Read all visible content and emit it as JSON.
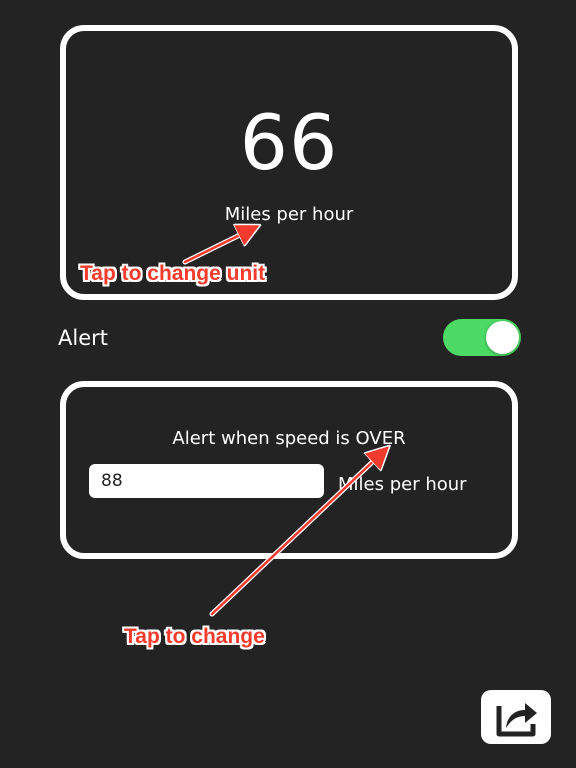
{
  "speed": {
    "value": "66",
    "unit": "Miles per hour"
  },
  "annotations": {
    "unit_hint": "Tap to change unit",
    "threshold_hint": "Tap to change"
  },
  "alert": {
    "label": "Alert",
    "enabled": true,
    "toggle_color": "#4cd964"
  },
  "threshold": {
    "title": "Alert when speed is OVER",
    "value": "88",
    "unit": "Miles per hour"
  },
  "share": {
    "icon": "share-icon"
  },
  "colors": {
    "background": "#232323",
    "annotation": "#f23b2c"
  }
}
